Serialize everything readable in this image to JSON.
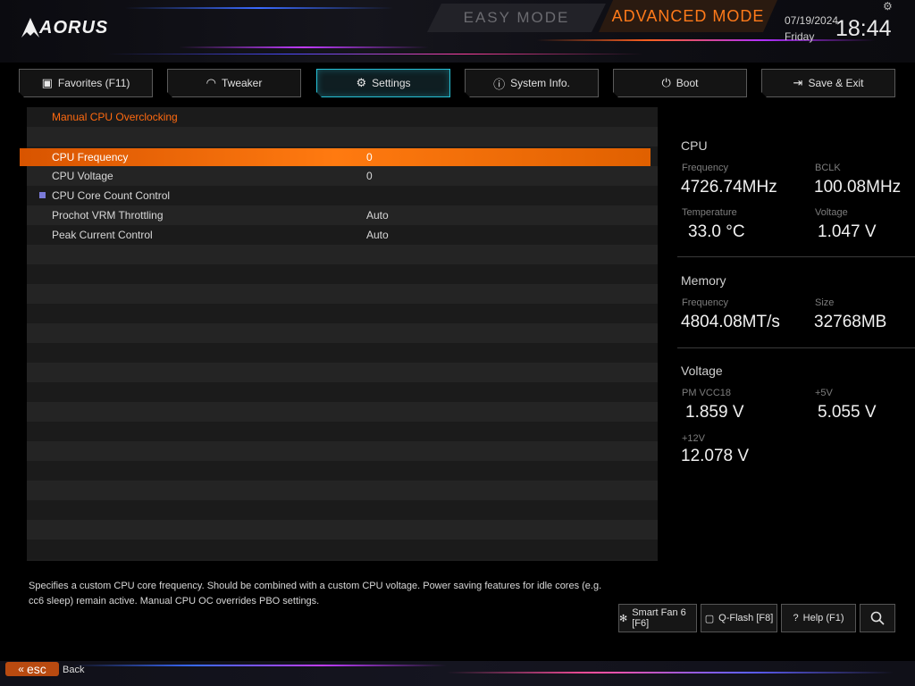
{
  "brand": {
    "logo_text": "AORUS"
  },
  "modes": {
    "easy": "EASY MODE",
    "advanced": "ADVANCED MODE"
  },
  "datetime": {
    "date": "07/19/2024",
    "day": "Friday",
    "time": "18:44"
  },
  "tabs": [
    {
      "label": "Favorites (F11)",
      "icon": "favorites-icon"
    },
    {
      "label": "Tweaker",
      "icon": "gauge-icon"
    },
    {
      "label": "Settings",
      "icon": "gear-icon"
    },
    {
      "label": "System Info.",
      "icon": "info-icon"
    },
    {
      "label": "Boot",
      "icon": "power-icon"
    },
    {
      "label": "Save & Exit",
      "icon": "exit-icon"
    }
  ],
  "settings": {
    "section_title": "Manual CPU Overclocking",
    "rows": [
      {
        "label": "CPU Frequency",
        "value": "0"
      },
      {
        "label": "CPU Voltage",
        "value": "0"
      },
      {
        "label": "CPU Core Count Control",
        "value": ""
      },
      {
        "label": "Prochot VRM Throttling",
        "value": "Auto"
      },
      {
        "label": "Peak Current Control",
        "value": "Auto"
      }
    ]
  },
  "info": {
    "cpu": {
      "title": "CPU",
      "frequency_label": "Frequency",
      "frequency": "4726.74MHz",
      "bclk_label": "BCLK",
      "bclk": "100.08MHz",
      "temp_label": "Temperature",
      "temp": "33.0 °C",
      "voltage_label": "Voltage",
      "voltage": "1.047 V"
    },
    "memory": {
      "title": "Memory",
      "frequency_label": "Frequency",
      "frequency": "4804.08MT/s",
      "size_label": "Size",
      "size": "32768MB"
    },
    "voltage": {
      "title": "Voltage",
      "pm_label": "PM VCC18",
      "pm": "1.859 V",
      "p5_label": "+5V",
      "p5": "5.055 V",
      "p12_label": "+12V",
      "p12": "12.078 V"
    }
  },
  "description": "Specifies a custom CPU core frequency. Should be combined with a custom CPU voltage. Power saving features for idle cores (e.g. cc6 sleep) remain active. Manual CPU OC overrides PBO settings.",
  "bottom_buttons": [
    {
      "label": "Smart Fan 6 [F6]",
      "icon": "fan-icon"
    },
    {
      "label": "Q-Flash [F8]",
      "icon": "chip-icon"
    },
    {
      "label": "Help (F1)",
      "icon": "help-icon"
    }
  ],
  "footer": {
    "esc": "esc",
    "back": "Back"
  },
  "colors": {
    "accent": "#ff7a1a",
    "active_tab": "#27c1d6",
    "highlight": "#ff6a00"
  }
}
